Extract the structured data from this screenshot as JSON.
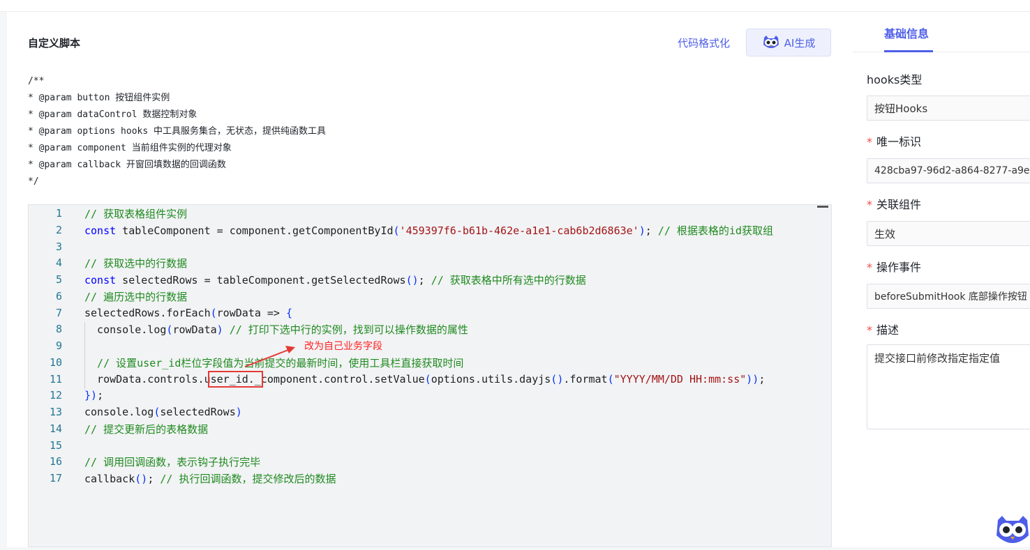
{
  "main": {
    "title": "自定义脚本",
    "format_label": "代码格式化",
    "ai_label": "AI生成",
    "doc_comment": [
      "/**",
      "* @param button 按钮组件实例",
      "* @param dataControl 数据控制对象",
      "* @param options hooks 中工具服务集合，无状态，提供纯函数工具",
      "* @param component 当前组件实例的代理对象",
      "* @param callback 开窗回填数据的回调函数",
      "*/"
    ]
  },
  "code": {
    "line_numbers": [
      "1",
      "2",
      "3",
      "4",
      "5",
      "6",
      "7",
      "8",
      "9",
      "10",
      "11",
      "12",
      "13",
      "14",
      "15",
      "16",
      "17"
    ],
    "l1": "// 获取表格组件实例",
    "l2_kw": "const",
    "l2_a": " tableComponent = component.getComponentById",
    "l2_p1": "(",
    "l2_str": "'459397f6-b61b-462e-a1e1-cab6b2d6863e'",
    "l2_p2": ")",
    "l2_b": "; ",
    "l2_cm": "// 根据表格的id获取组",
    "l4": "// 获取选中的行数据",
    "l5_kw": "const",
    "l5_a": " selectedRows = tableComponent.getSelectedRows",
    "l5_p": "()",
    "l5_b": "; ",
    "l5_cm": "// 获取表格中所有选中的行数据",
    "l6": "// 遍历选中的行数据",
    "l7_a": "selectedRows.forEach",
    "l7_p1": "(",
    "l7_b": "rowData => ",
    "l7_p2": "{",
    "l8_a": "  console.log",
    "l8_p1": "(",
    "l8_b": "rowData",
    "l8_p2": ")",
    "l8_c": " ",
    "l8_cm": "// 打印下选中行的实例，找到可以操作数据的属性",
    "l10_cm": "  // 设置user_id栏位字段值为当前提交的最新时间，使用工具栏直接获取时间",
    "l11_a": "  rowData.controls.user_id._component.control.setValue",
    "l11_p1": "(",
    "l11_b": "options.utils.dayjs",
    "l11_p2": "()",
    "l11_c": ".format",
    "l11_p3": "(",
    "l11_str": "\"YYYY/MM/DD HH:mm:ss\"",
    "l11_p4": "))",
    "l11_d": ";",
    "l12_p": "})",
    "l12_b": ";",
    "l13_a": "console.log",
    "l13_p1": "(",
    "l13_b": "selectedRows",
    "l13_p2": ")",
    "l14": "// 提交更新后的表格数据",
    "l16": "// 调用回调函数，表示钩子执行完毕",
    "l17_a": "callback",
    "l17_p": "()",
    "l17_b": "; ",
    "l17_cm": "// 执行回调函数，提交修改后的数据"
  },
  "annotation": {
    "text": "改为自己业务字段"
  },
  "panel": {
    "tab": "基础信息",
    "hooks_type_label": "hooks类型",
    "hooks_type_value": "按钮Hooks",
    "uid_label": "唯一标识",
    "uid_value": "428cba97-96d2-a864-8277-a9e",
    "component_label": "关联组件",
    "component_value": "生效",
    "event_label": "操作事件",
    "event_value": "beforeSubmitHook 底部操作按钮",
    "desc_label": "描述",
    "desc_value": "提交接口前修改指定指定值",
    "required_mark": "*"
  },
  "colors": {
    "accent": "#4e5ee8",
    "comment": "#1f8a1f",
    "keyword": "#0000ff",
    "string": "#a31515",
    "annotation": "#ff1f1f"
  }
}
